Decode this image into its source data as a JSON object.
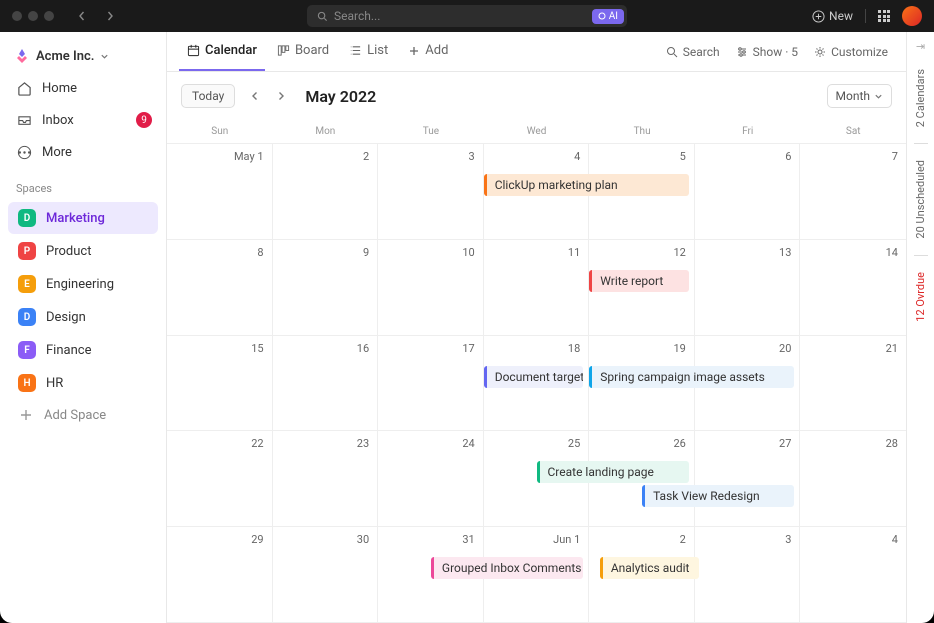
{
  "topbar": {
    "search_placeholder": "Search...",
    "ai_label": "AI",
    "new_label": "New"
  },
  "workspace": {
    "name": "Acme Inc."
  },
  "nav": {
    "home": "Home",
    "inbox": "Inbox",
    "inbox_badge": "9",
    "more": "More"
  },
  "spaces_label": "Spaces",
  "spaces": [
    {
      "initial": "D",
      "label": "Marketing",
      "color": "#10b981",
      "active": true
    },
    {
      "initial": "P",
      "label": "Product",
      "color": "#ef4444",
      "active": false
    },
    {
      "initial": "E",
      "label": "Engineering",
      "color": "#f59e0b",
      "active": false
    },
    {
      "initial": "D",
      "label": "Design",
      "color": "#3b82f6",
      "active": false
    },
    {
      "initial": "F",
      "label": "Finance",
      "color": "#8b5cf6",
      "active": false
    },
    {
      "initial": "H",
      "label": "HR",
      "color": "#f97316",
      "active": false
    }
  ],
  "add_space_label": "Add Space",
  "views": {
    "calendar": "Calendar",
    "board": "Board",
    "list": "List",
    "add": "Add"
  },
  "view_actions": {
    "search": "Search",
    "show": "Show · 5",
    "customize": "Customize"
  },
  "calendar": {
    "today": "Today",
    "title": "May 2022",
    "range_selector": "Month"
  },
  "days": [
    "Sun",
    "Mon",
    "Tue",
    "Wed",
    "Thu",
    "Fri",
    "Sat"
  ],
  "cells": [
    "May 1",
    "2",
    "3",
    "4",
    "5",
    "6",
    "7",
    "8",
    "9",
    "10",
    "11",
    "12",
    "13",
    "14",
    "15",
    "16",
    "17",
    "18",
    "19",
    "20",
    "21",
    "22",
    "23",
    "24",
    "25",
    "26",
    "27",
    "28",
    "29",
    "30",
    "31",
    "Jun 1",
    "2",
    "3",
    "4"
  ],
  "events": [
    {
      "label": "ClickUp marketing plan",
      "row": 0,
      "col_start": 3,
      "span": 2,
      "bg": "#fde8d4",
      "border": "#f97316"
    },
    {
      "label": "Write report",
      "row": 1,
      "col_start": 4,
      "span": 1,
      "bg": "#fde2e2",
      "border": "#ef4444"
    },
    {
      "label": "Document target users",
      "row": 2,
      "col_start": 3,
      "span": 1,
      "bg": "#eef0fb",
      "border": "#6366f1"
    },
    {
      "label": "Spring campaign image assets",
      "row": 2,
      "col_start": 4,
      "span": 2,
      "bg": "#eaf3fb",
      "border": "#0ea5e9"
    },
    {
      "label": "Create landing page",
      "row": 3,
      "col_start": 3.5,
      "span": 1.5,
      "bg": "#e6f7f1",
      "border": "#10b981"
    },
    {
      "label": "Task View Redesign",
      "row": 3,
      "col_start": 4.5,
      "span": 1.5,
      "bg": "#eaf3fb",
      "border": "#3b82f6"
    },
    {
      "label": "Grouped Inbox Comments",
      "row": 4,
      "col_start": 2.5,
      "span": 1.5,
      "bg": "#fce8f0",
      "border": "#ec4899"
    },
    {
      "label": "Analytics audit",
      "row": 4,
      "col_start": 4.1,
      "span": 1,
      "bg": "#fef6e0",
      "border": "#f59e0b"
    }
  ],
  "rail": {
    "calendars": "2 Calendars",
    "unscheduled": "20 Unscheduled",
    "overdue": "12 Ovrdue"
  }
}
